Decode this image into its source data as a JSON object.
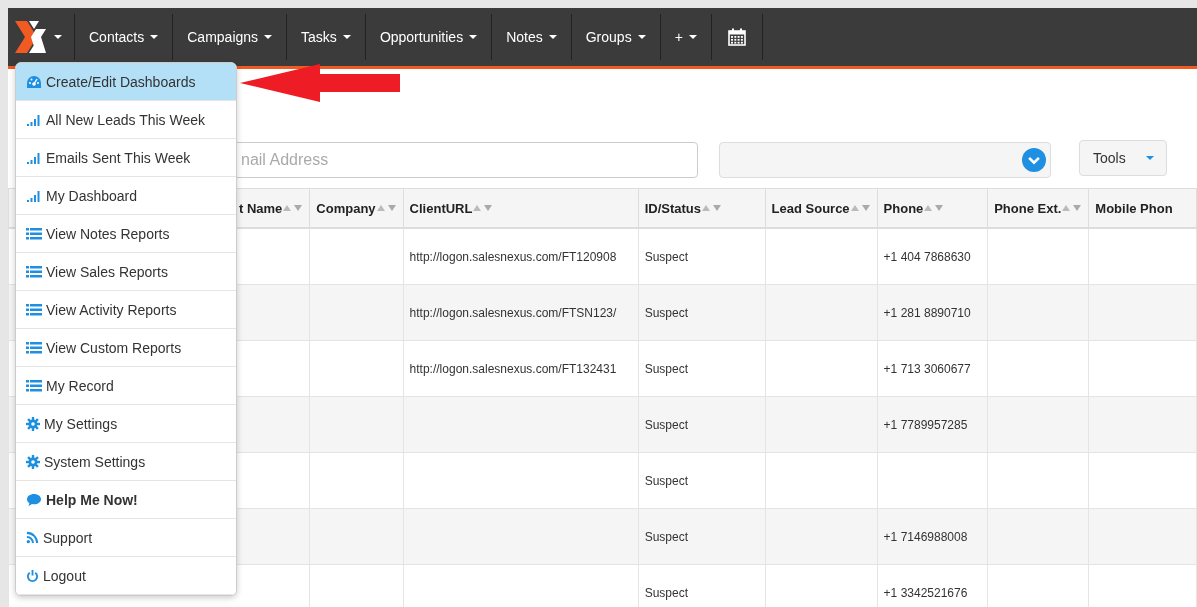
{
  "nav": {
    "items": [
      {
        "label": "Contacts"
      },
      {
        "label": "Campaigns"
      },
      {
        "label": "Tasks"
      },
      {
        "label": "Opportunities"
      },
      {
        "label": "Notes"
      },
      {
        "label": "Groups"
      },
      {
        "label": "+"
      }
    ]
  },
  "menu": {
    "items": [
      {
        "label": "Create/Edit Dashboards",
        "kind": "dashboard",
        "selected": true,
        "bold": false
      },
      {
        "label": "All New Leads This Week",
        "kind": "signal",
        "selected": false,
        "bold": false
      },
      {
        "label": "Emails Sent This Week",
        "kind": "signal",
        "selected": false,
        "bold": false
      },
      {
        "label": "My Dashboard",
        "kind": "signal",
        "selected": false,
        "bold": false
      },
      {
        "label": "View Notes Reports",
        "kind": "list",
        "selected": false,
        "bold": false
      },
      {
        "label": "View Sales Reports",
        "kind": "list",
        "selected": false,
        "bold": false
      },
      {
        "label": "View Activity Reports",
        "kind": "list",
        "selected": false,
        "bold": false
      },
      {
        "label": "View Custom Reports",
        "kind": "list",
        "selected": false,
        "bold": false
      },
      {
        "label": "My Record",
        "kind": "list",
        "selected": false,
        "bold": false
      },
      {
        "label": "My Settings",
        "kind": "gear",
        "selected": false,
        "bold": false
      },
      {
        "label": "System Settings",
        "kind": "gear",
        "selected": false,
        "bold": false
      },
      {
        "label": "Help Me Now!",
        "kind": "comment",
        "selected": false,
        "bold": true
      },
      {
        "label": "Support",
        "kind": "rss",
        "selected": false,
        "bold": false
      },
      {
        "label": "Logout",
        "kind": "power",
        "selected": false,
        "bold": false
      }
    ]
  },
  "search": {
    "placeholder": "nail Address"
  },
  "tools_button": {
    "label": "Tools"
  },
  "table": {
    "columns": [
      "t Name",
      "Company",
      "ClientURL",
      "ID/Status",
      "Lead Source",
      "Phone",
      "Phone Ext.",
      "Mobile Phon"
    ],
    "rows": [
      {
        "client_url": "http://logon.salesnexus.com/FT120908",
        "id_status": "Suspect",
        "phone": "+1 404 7868630"
      },
      {
        "client_url": "http://logon.salesnexus.com/FTSN123/",
        "id_status": "Suspect",
        "phone": "+1 281 8890710"
      },
      {
        "client_url": "http://logon.salesnexus.com/FT132431",
        "id_status": "Suspect",
        "phone": "+1 713 3060677"
      },
      {
        "id_status": "Suspect",
        "phone": "+1 7789957285"
      },
      {
        "id_status": "Suspect"
      },
      {
        "id_status": "Suspect",
        "phone": "+1 7146988008"
      },
      {
        "id_status": "Suspect",
        "phone": "+1 3342521676"
      }
    ]
  }
}
